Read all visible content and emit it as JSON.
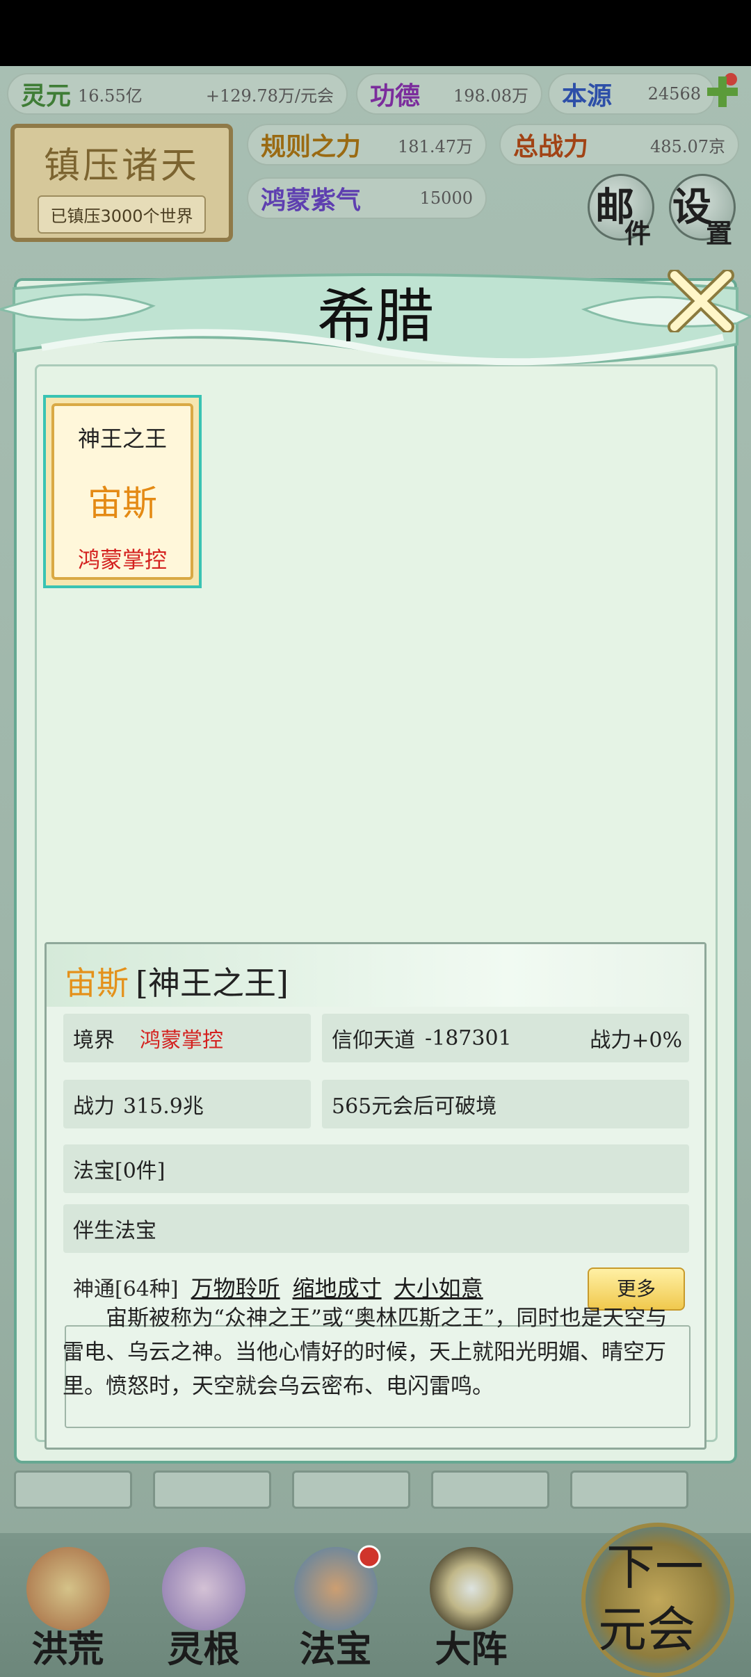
{
  "resources": {
    "lingyuan": {
      "label": "灵元",
      "value": "16.55亿"
    },
    "rate": {
      "value": "+129.78万/元会"
    },
    "gongde": {
      "label": "功德",
      "value": "198.08万"
    },
    "benyuan": {
      "label": "本源",
      "value": "24568"
    },
    "guize": {
      "label": "规则之力",
      "value": "181.47万"
    },
    "zhanli": {
      "label": "总战力",
      "value": "485.07京"
    },
    "hongmeng": {
      "label": "鸿蒙紫气",
      "value": "15000"
    }
  },
  "plaque": {
    "title": "镇压诸天",
    "subtitle": "已镇压3000个世界"
  },
  "top_buttons": {
    "mail_1": "邮",
    "mail_2": "件",
    "settings_1": "设",
    "settings_2": "置"
  },
  "modal": {
    "title": "希腊",
    "card": {
      "rank": "神王之王",
      "name": "宙斯",
      "realm": "鸿蒙掌控"
    },
    "detail": {
      "name": "宙斯",
      "rank": "[神王之王]",
      "realm_label": "境界",
      "realm_value": "鸿蒙掌控",
      "faith_label": "信仰天道",
      "faith_value": "-187301",
      "power_bonus": "战力+0%",
      "power_label": "战力",
      "power_value": "315.9兆",
      "breakthrough": "565元会后可破境",
      "treasure": "法宝[0件]",
      "companion_treasure": "伴生法宝",
      "skills_label": "神通[64种]",
      "skills": [
        "万物聆听",
        "缩地成寸",
        "大小如意"
      ],
      "more_label": "更多",
      "description": "宙斯被称为“众神之王”或“奥林匹斯之王”，同时也是天空与雷电、乌云之神。当他心情好的时候，天上就阳光明媚、晴空万里。愤怒时，天空就会乌云密布、电闪雷鸣。"
    }
  },
  "bottom_nav": [
    {
      "label": "洪荒"
    },
    {
      "label": "灵根"
    },
    {
      "label": "法宝"
    },
    {
      "label": "大阵"
    }
  ],
  "next_era": {
    "line1": "下一",
    "line2": "元会"
  },
  "colors": {
    "accent_teal": "#66a892",
    "gold": "#e4911b",
    "red": "#d4211f"
  }
}
